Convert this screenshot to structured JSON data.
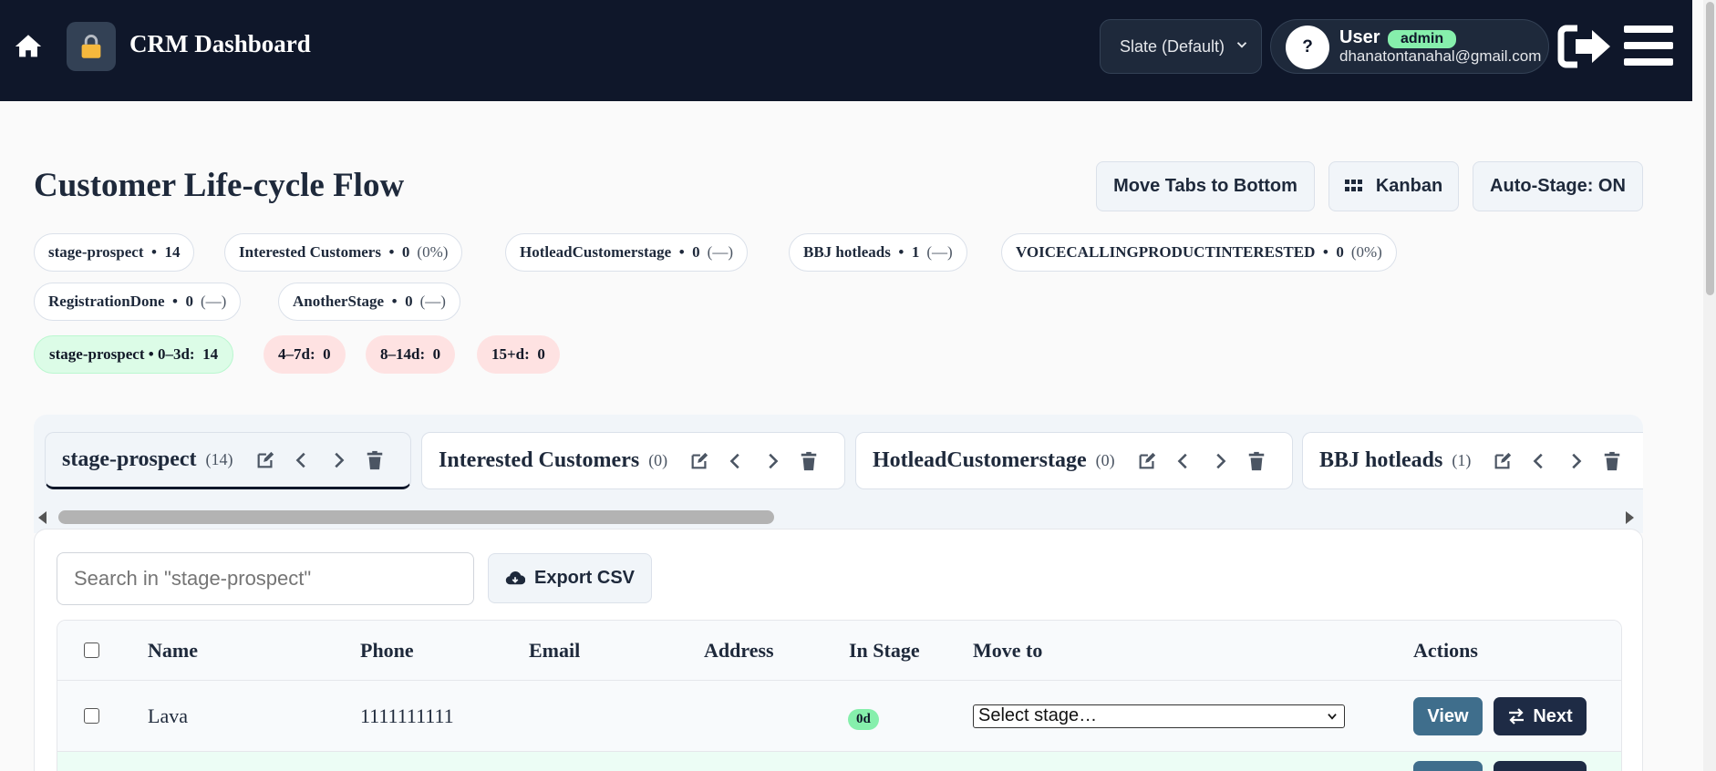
{
  "header": {
    "brand": "CRM Dashboard",
    "theme_select": "Slate (Default)",
    "help": "?",
    "user_label": "User",
    "role": "admin",
    "email": "dhanatontanahal@gmail.com"
  },
  "page": {
    "title": "Customer Life-cycle Flow",
    "move_tabs_label": "Move Tabs to Bottom",
    "kanban_label": "Kanban",
    "auto_stage_label": "Auto-Stage: ON"
  },
  "stage_chips": [
    {
      "name": "stage-prospect",
      "count": "14",
      "pct": ""
    },
    {
      "name": "Interested Customers",
      "count": "0",
      "pct": "(0%)"
    },
    {
      "name": "HotleadCustomerstage",
      "count": "0",
      "pct": "(—)"
    },
    {
      "name": "BBJ hotleads",
      "count": "1",
      "pct": "(—)"
    },
    {
      "name": "VOICECALLINGPRODUCTINTERESTED",
      "count": "0",
      "pct": "(0%)"
    },
    {
      "name": "RegistrationDone",
      "count": "0",
      "pct": "(—)"
    },
    {
      "name": "AnotherStage",
      "count": "0",
      "pct": "(—)"
    }
  ],
  "aging": [
    {
      "label": "stage-prospect • 0–3d:",
      "value": "14",
      "color": "#dcfce7"
    },
    {
      "label": "4–7d:",
      "value": "0",
      "color": "#fee2e2"
    },
    {
      "label": "8–14d:",
      "value": "0",
      "color": "#fee2e2"
    },
    {
      "label": "15+d:",
      "value": "0",
      "color": "#fee2e2"
    }
  ],
  "tabs": [
    {
      "name": "stage-prospect",
      "count": "(14)"
    },
    {
      "name": "Interested Customers",
      "count": "(0)"
    },
    {
      "name": "HotleadCustomerstage",
      "count": "(0)"
    },
    {
      "name": "BBJ hotleads",
      "count": "(1)"
    }
  ],
  "toolbar": {
    "search_placeholder": "Search in \"stage-prospect\"",
    "export_label": "Export CSV"
  },
  "table": {
    "columns": [
      "Name",
      "Phone",
      "Email",
      "Address",
      "In Stage",
      "Move to",
      "Actions"
    ],
    "rows": [
      {
        "name": "Lava",
        "phone": "1111111111",
        "email": "",
        "address": "",
        "in_stage": "0d",
        "move_to": "Select stage…",
        "view": "View",
        "next": "Next"
      }
    ]
  },
  "colors": {
    "topbar": "#0f172a",
    "accent_green": "#86efac",
    "view_button": "#3f6e8c",
    "next_button": "#1e2b45"
  }
}
